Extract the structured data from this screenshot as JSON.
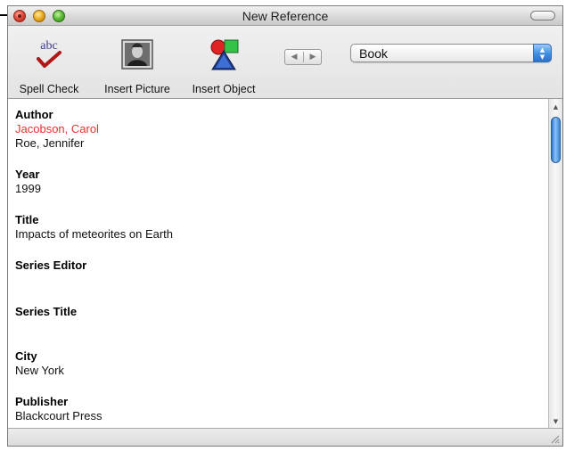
{
  "window": {
    "title": "New Reference"
  },
  "toolbar": {
    "tools": [
      {
        "label": "Spell Check",
        "icon": "spell-check-icon"
      },
      {
        "label": "Insert Picture",
        "icon": "insert-picture-icon"
      },
      {
        "label": "Insert Object",
        "icon": "insert-object-icon"
      }
    ],
    "spell_icon_text": "abc",
    "reference_type": "Book"
  },
  "fields": [
    {
      "name": "Author",
      "values": [
        "Jacobson, Carol",
        "Roe, Jennifer"
      ]
    },
    {
      "name": "Year",
      "values": [
        "1999"
      ]
    },
    {
      "name": "Title",
      "values": [
        "Impacts of meteorites on Earth"
      ]
    },
    {
      "name": "Series Editor",
      "values": []
    },
    {
      "name": "Series Title",
      "values": []
    },
    {
      "name": "City",
      "values": [
        "New York"
      ]
    },
    {
      "name": "Publisher",
      "values": [
        "Blackcourt Press"
      ]
    }
  ],
  "colors": {
    "highlight_author": "#e8322d",
    "select_accent": "#3f8ee2"
  }
}
